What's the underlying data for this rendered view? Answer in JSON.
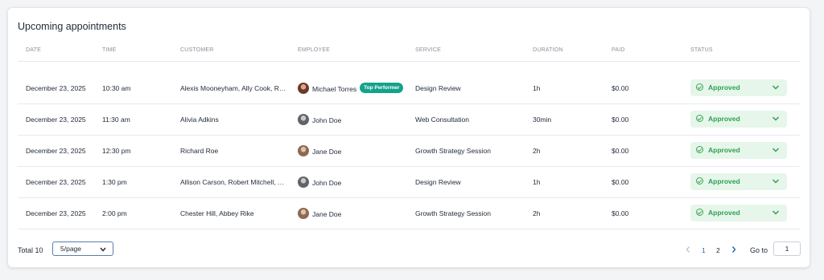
{
  "card": {
    "title": "Upcoming appointments"
  },
  "columns": [
    "DATE",
    "TIME",
    "CUSTOMER",
    "EMPLOYEE",
    "SERVICE",
    "DURATION",
    "PAID",
    "STATUS"
  ],
  "rows": [
    {
      "date": "December 23, 2025",
      "time": "10:30 am",
      "customer": "Alexis Mooneyham, Ally Cook, Ro...",
      "employee": "Michael Torres",
      "employee_avatar": "dark",
      "badge": "Top Performer",
      "service": "Design Review",
      "duration": "1h",
      "paid": "$0.00",
      "status": "Approved"
    },
    {
      "date": "December 23, 2025",
      "time": "11:30 am",
      "customer": "Alivia Adkins",
      "employee": "John Doe",
      "employee_avatar": "gray",
      "badge": "",
      "service": "Web Consultation",
      "duration": "30min",
      "paid": "$0.00",
      "status": "Approved"
    },
    {
      "date": "December 23, 2025",
      "time": "12:30 pm",
      "customer": "Richard Roe",
      "employee": "Jane Doe",
      "employee_avatar": "brown",
      "badge": "",
      "service": "Growth Strategy Session",
      "duration": "2h",
      "paid": "$0.00",
      "status": "Approved"
    },
    {
      "date": "December 23, 2025",
      "time": "1:30 pm",
      "customer": "Allison Carson, Robert Mitchell, A...",
      "employee": "John Doe",
      "employee_avatar": "gray",
      "badge": "",
      "service": "Design Review",
      "duration": "1h",
      "paid": "$0.00",
      "status": "Approved"
    },
    {
      "date": "December 23, 2025",
      "time": "2:00 pm",
      "customer": "Chester Hill, Abbey Rike",
      "employee": "Jane Doe",
      "employee_avatar": "brown",
      "badge": "",
      "service": "Growth Strategy Session",
      "duration": "2h",
      "paid": "$0.00",
      "status": "Approved"
    }
  ],
  "footer": {
    "total_label": "Total 10",
    "page_size": "5/page",
    "pages": [
      "1",
      "2"
    ],
    "current_page": "1",
    "goto_label": "Go to",
    "goto_value": "1"
  },
  "colors": {
    "status_bg": "#e6f6ea",
    "status_text": "#2e9f52",
    "badge_bg": "#13a38a",
    "active_page": "#2a64b8"
  },
  "icons": [
    "check-circle-icon",
    "chevron-down-icon",
    "chevron-left-icon",
    "chevron-right-icon",
    "avatar"
  ]
}
